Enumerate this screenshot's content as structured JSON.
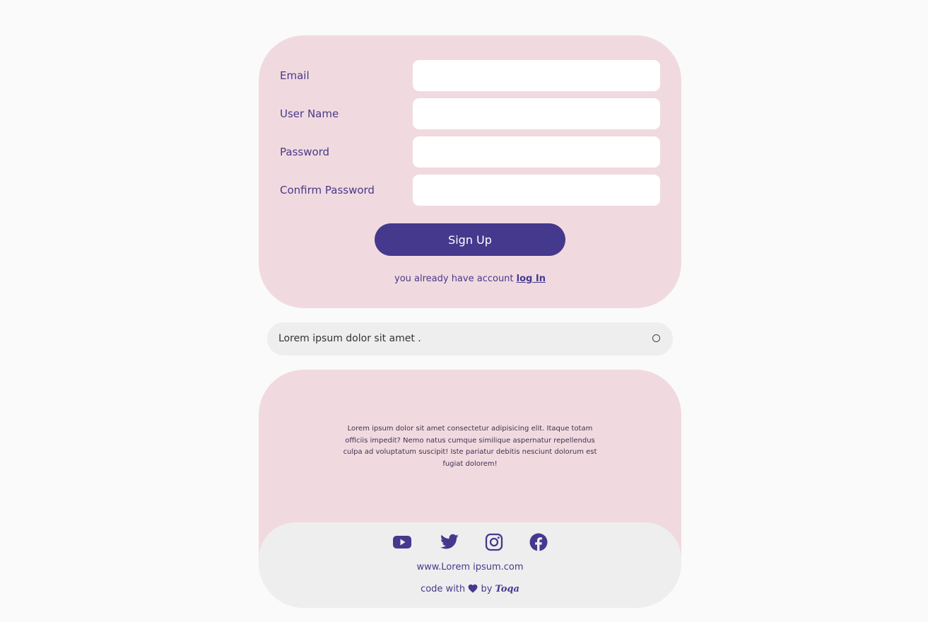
{
  "signup_form": {
    "fields": [
      {
        "label": "Email",
        "value": "",
        "placeholder": ""
      },
      {
        "label": "User Name",
        "value": "",
        "placeholder": ""
      },
      {
        "label": "Password",
        "value": "",
        "placeholder": ""
      },
      {
        "label": "Confirm Password",
        "value": "",
        "placeholder": ""
      }
    ],
    "submit_label": "Sign Up",
    "login_prompt": "you already have account",
    "login_link": "log In"
  },
  "notice": {
    "text": "Lorem ipsum dolor sit amet ."
  },
  "footer": {
    "description": "Lorem ipsum dolor sit amet consectetur adipisicing elit. Itaque totam officiis impedit? Nemo natus cumque similique aspernatur repellendus culpa ad voluptatum suscipit! Iste pariatur debitis nesciunt dolorum est fugiat dolorem!",
    "social_icons": [
      "youtube-icon",
      "twitter-icon",
      "instagram-icon",
      "facebook-icon"
    ],
    "website": "www.Lorem ipsum.com",
    "credit_prefix": "code with",
    "credit_by": "by",
    "author": "Toqa"
  },
  "colors": {
    "accent": "#45398e",
    "card_background": "#f1dadf",
    "bar_background": "#eeeeee",
    "page_background": "#fafafa"
  }
}
